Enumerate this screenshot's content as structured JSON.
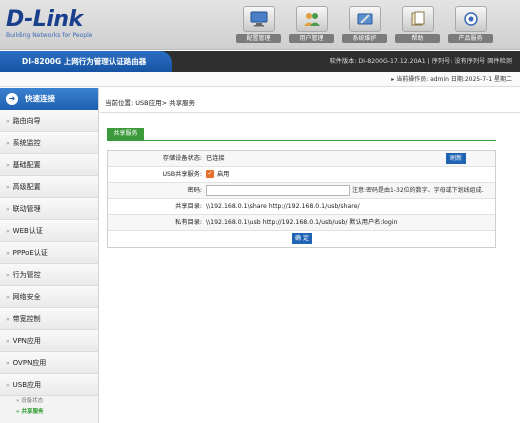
{
  "brand": {
    "logo": "D-Link",
    "tagline": "Building Networks for People"
  },
  "top_nav": [
    {
      "label": "配置管理",
      "icon": "monitor-icon"
    },
    {
      "label": "用户管理",
      "icon": "users-icon"
    },
    {
      "label": "系统维护",
      "icon": "tools-icon"
    },
    {
      "label": "帮助",
      "icon": "help-book-icon"
    },
    {
      "label": "产品服务",
      "icon": "service-icon"
    }
  ],
  "titlebar": {
    "model": "DI-8200G 上网行为管理认证路由器",
    "info": "软件版本: DI-8200G-17.12.20A1 | 序列号: 没有序列号   固件检测"
  },
  "operator": {
    "text": "▸ 当前操作员: admin     日期:2025-7-1     星期二"
  },
  "sidebar": {
    "quick": "快速连接",
    "items": [
      "路由向导",
      "系统监控",
      "基础配置",
      "高级配置",
      "联动管理",
      "WEB认证",
      "PPPoE认证",
      "行为管控",
      "网络安全",
      "带宽控制",
      "VPN应用",
      "OVPN应用",
      "USB应用"
    ],
    "subitems": [
      {
        "label": "» 设备状态",
        "active": false
      },
      {
        "label": "» 共享服务",
        "active": true
      }
    ]
  },
  "content": {
    "breadcrumb": "当前位置: USB应用> 共享服务",
    "tab": "共享服务",
    "form": {
      "storage_label": "存储设备状态:",
      "storage_value": "已连接",
      "refresh_btn": "刷新",
      "usb_share_label": "USB共享服务:",
      "usb_share_value": "启用",
      "password_label": "密码:",
      "password_value": "",
      "password_note": "注意:密码是由1-32位的数字、字母或下划线组成.",
      "share_dir_label": "共享目录:",
      "share_dir_value": "\\\\192.168.0.1\\share   http://192.168.0.1/usb/share/",
      "private_dir_label": "私有目录:",
      "private_dir_value": "\\\\192.168.0.1\\usb   http://192.168.0.1/usb/usb/  默认用户名:login",
      "ok_btn": "确 定"
    }
  }
}
